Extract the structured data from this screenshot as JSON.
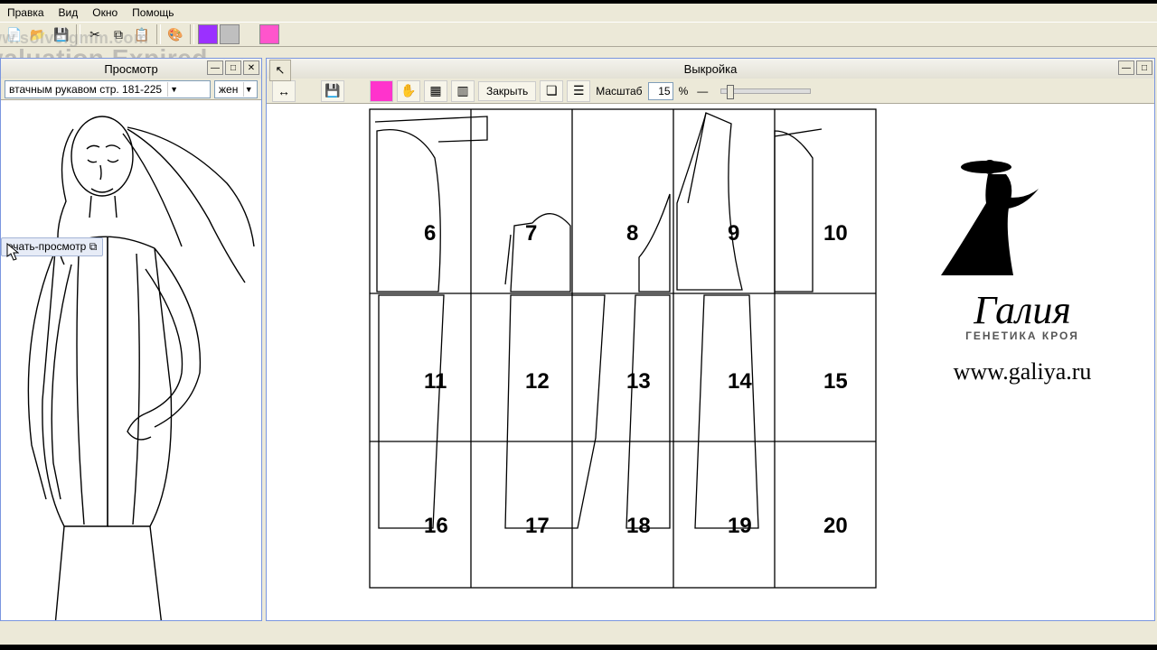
{
  "menu": {
    "edit": "Правка",
    "view": "Вид",
    "window": "Окно",
    "help": "Помощь"
  },
  "watermark": {
    "site": "ww.solveigmm.com",
    "line": "valuation Expired"
  },
  "preview": {
    "title": "Просмотр",
    "dd_pages": "втачным рукавом стр. 181-225",
    "dd_sex": "жен",
    "tooltip": "ечать-просмотр"
  },
  "pattern": {
    "title": "Выкройка",
    "close_btn": "Закрыть",
    "scale_label": "Масштаб",
    "scale_value": "15",
    "scale_unit": "%"
  },
  "logo": {
    "brand": "Галия",
    "tag": "ГЕНЕТИКА КРОЯ",
    "site": "www.galiya.ru"
  },
  "pages": {
    "p6": "6",
    "p7": "7",
    "p8": "8",
    "p9": "9",
    "p10": "10",
    "p11": "11",
    "p12": "12",
    "p13": "13",
    "p14": "14",
    "p15": "15",
    "p16": "16",
    "p17": "17",
    "p18": "18",
    "p19": "19",
    "p20": "20"
  }
}
